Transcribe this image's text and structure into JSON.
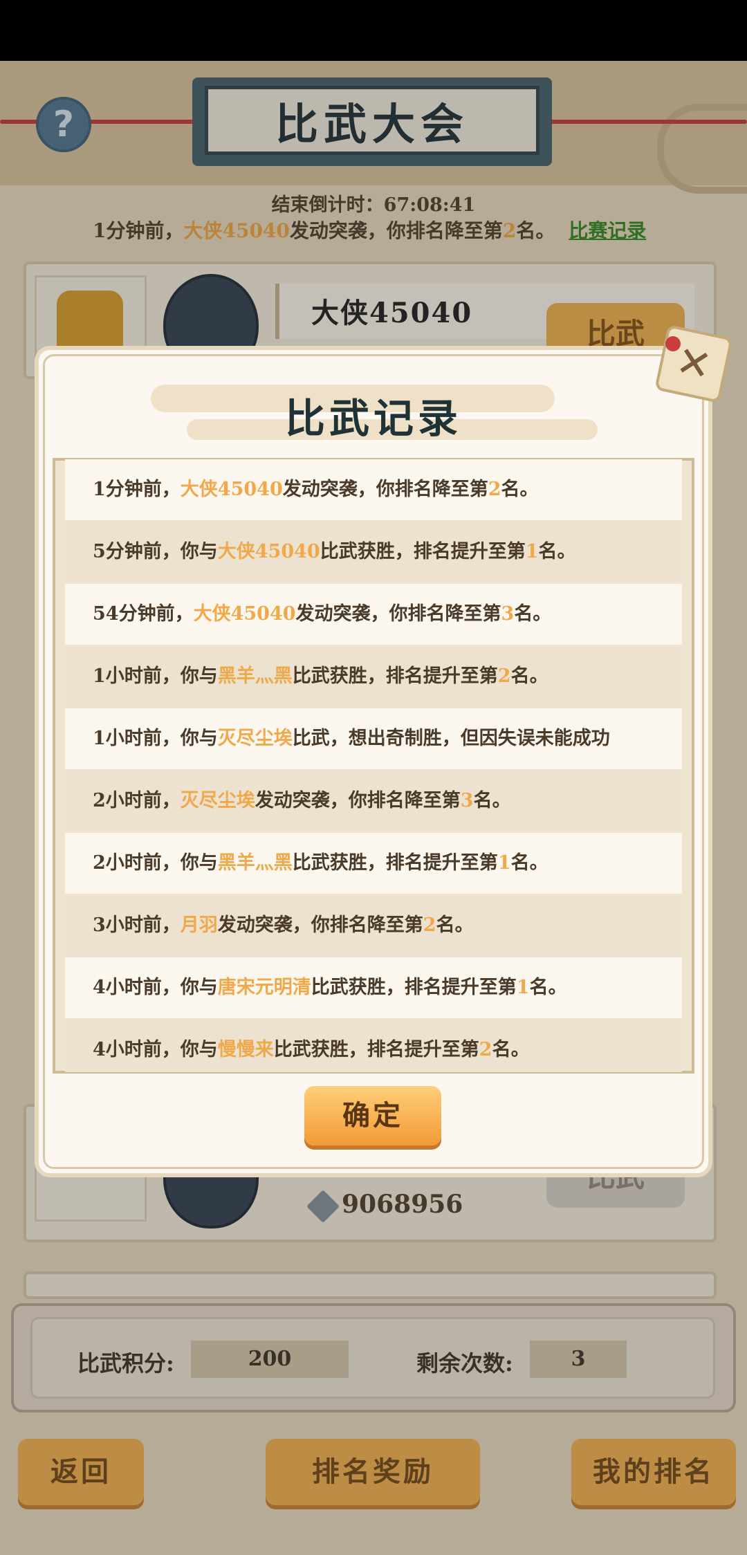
{
  "screen_title": "比武大会",
  "help_icon": "?",
  "countdown": "结束倒计时：67:08:41",
  "notice": {
    "prefix": "1分钟前，",
    "player": "大侠45040",
    "suffix": "发动突袭，你排名降至第",
    "rank": "2",
    "end": "名。",
    "link": "比赛记录"
  },
  "opponent_top": {
    "name": "大侠45040",
    "fight_label": "比武"
  },
  "opponent_bottom": {
    "power": "9068956",
    "fight_label": "比武"
  },
  "stats": {
    "points_label": "比武积分:",
    "points_value": "200",
    "remaining_label": "剩余次数:",
    "remaining_value": "3"
  },
  "bottom_buttons": {
    "back": "返回",
    "rank_rewards": "排名奖励",
    "my_rank": "我的排名"
  },
  "dialog": {
    "title": "比武记录",
    "confirm": "确定",
    "records": [
      {
        "pre": "1分钟前，",
        "player": "大侠45040",
        "mid": "发动突袭，你排名降至第",
        "rank": "2",
        "post": "名。"
      },
      {
        "pre": "5分钟前，你与",
        "player": "大侠45040",
        "mid": "比武获胜，排名提升至第",
        "rank": "1",
        "post": "名。"
      },
      {
        "pre": "54分钟前，",
        "player": "大侠45040",
        "mid": "发动突袭，你排名降至第",
        "rank": "3",
        "post": "名。"
      },
      {
        "pre": "1小时前，你与",
        "player": "黑羊灬黑",
        "mid": "比武获胜，排名提升至第",
        "rank": "2",
        "post": "名。"
      },
      {
        "pre": "1小时前，你与",
        "player": "灭尽尘埃",
        "mid": "比武，想出奇制胜，但因失误未能成功",
        "rank": "",
        "post": ""
      },
      {
        "pre": "2小时前，",
        "player": "灭尽尘埃",
        "mid": "发动突袭，你排名降至第",
        "rank": "3",
        "post": "名。"
      },
      {
        "pre": "2小时前，你与",
        "player": "黑羊灬黑",
        "mid": "比武获胜，排名提升至第",
        "rank": "1",
        "post": "名。"
      },
      {
        "pre": "3小时前，",
        "player": "月羽",
        "mid": "发动突袭，你排名降至第",
        "rank": "2",
        "post": "名。"
      },
      {
        "pre": "4小时前，你与",
        "player": "唐宋元明清",
        "mid": "比武获胜，排名提升至第",
        "rank": "1",
        "post": "名。"
      },
      {
        "pre": "4小时前，你与",
        "player": "慢慢来",
        "mid": "比武获胜，排名提升至第",
        "rank": "2",
        "post": "名。"
      }
    ]
  },
  "colors": {
    "highlight": "#f0a94a",
    "link": "#3e8f2e",
    "button": "#f2b55a"
  }
}
